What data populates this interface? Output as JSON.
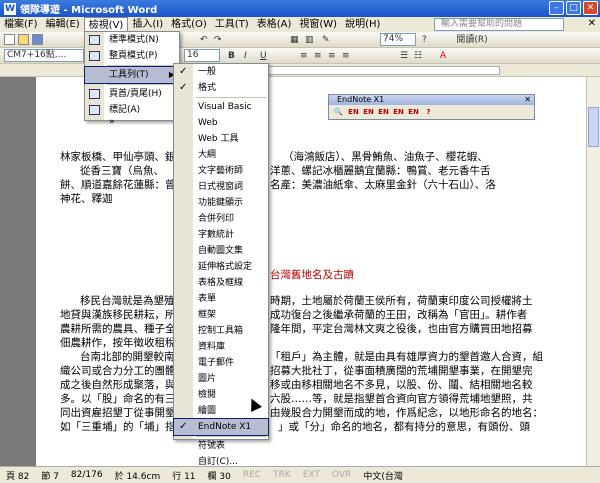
{
  "window": {
    "title": "領隊導遊 - Microsoft Word"
  },
  "menubar": {
    "items": [
      "檔案(F)",
      "編輯(E)",
      "檢視(V)",
      "插入(I)",
      "格式(O)",
      "工具(T)",
      "表格(A)",
      "視窗(W)",
      "說明(H)"
    ],
    "ask_placeholder": "輸入需要幫助的問題"
  },
  "toolbar": {
    "zoom": "74%",
    "read_label": "閱讀(R)",
    "font_name": "CM7+16點,...",
    "font_size": "16"
  },
  "view_menu": {
    "items": [
      "標準模式(N)",
      "整頁模式(P)",
      "工具列(T)",
      "頁首/頁尾(H)",
      "標記(A)"
    ],
    "more": "»"
  },
  "toolbars_menu": {
    "items": [
      {
        "label": "一般",
        "checked": true
      },
      {
        "label": "格式",
        "checked": true
      },
      {
        "label": "Visual Basic",
        "checked": false
      },
      {
        "label": "Web",
        "checked": false
      },
      {
        "label": "Web 工具",
        "checked": false
      },
      {
        "label": "大綱",
        "checked": false
      },
      {
        "label": "文字藝術師",
        "checked": false
      },
      {
        "label": "日式視窗詞",
        "checked": false
      },
      {
        "label": "功能鍵顯示",
        "checked": false
      },
      {
        "label": "合併列印",
        "checked": false
      },
      {
        "label": "字數統計",
        "checked": false
      },
      {
        "label": "自動圖文集",
        "checked": false
      },
      {
        "label": "延伸格式設定",
        "checked": false
      },
      {
        "label": "表格及框線",
        "checked": false
      },
      {
        "label": "表單",
        "checked": false
      },
      {
        "label": "框架",
        "checked": false
      },
      {
        "label": "控制工具箱",
        "checked": false
      },
      {
        "label": "資料庫",
        "checked": false
      },
      {
        "label": "電子郵件",
        "checked": false
      },
      {
        "label": "圖片",
        "checked": false
      },
      {
        "label": "檢閱",
        "checked": false
      },
      {
        "label": "繪圖",
        "checked": false
      },
      {
        "label": "EndNote X1",
        "checked": true
      },
      {
        "label": "符號表",
        "checked": false
      },
      {
        "label": "自訂(C)...",
        "checked": false
      }
    ]
  },
  "endnote": {
    "title": "EndNote X1",
    "buttons": [
      "EN",
      "EN",
      "EN",
      "EN",
      "EN"
    ]
  },
  "document": {
    "lines": [
      "林家板橋、甲仙亭頭、銀",
      "（海鴻飯店）、黑骨鮪魚、油魚子、櫻花蝦、",
      "從香三寶（烏魚、",
      "洋蔥、螺記冰櫃麗鵝宜蘭縣：鴨賞、老元香牛舌",
      "餅、順道嘉餘花蓮縣：曾",
      "名產：美濃油紙傘、太麻里金針（六十石山）、洛",
      "神花、釋迦",
      "台灣舊地名及古蹟",
      "移民台灣就是為墾殖",
      "時期，土地屬於荷蘭王侯所有，荷蘭東印度公司授權將土",
      "地貸與漢族移民耕耘，所",
      "成功復台之後繼承荷蘭的王田，改稱為「官田」。耕作者",
      "農耕所需的農具、種子全",
      "隆年間，平定台灣林文爽之役後，也由官方購買田地招募",
      "佃農耕作，按年徵收租稅",
      "台南北部的開墾較南部",
      "「租戶」為主體，就是由具有雄厚資力的墾首邀人合資，組",
      "織公司或合力分工的團體",
      "招募大批社丁，從事面積廣闊的荒埔開墾事業，在開墾完",
      "成之後自然形成聚落，與",
      "移或由移相關地名不多見，以股、份、鬮、結相關地名較",
      "多。以「股」命名的有三",
      "六股……等，就是指墾首合資向官方領得荒埔地墾照，共",
      "同出資雇招墾丁從事開墾",
      "由幾股合力開墾而成的地，作爲紀念，以地形命名的地名：",
      "如「三重埔」的「埔」指",
      "」或「分」命名的地名，都有持分的意思，有頭份、頭"
    ]
  },
  "statusbar": {
    "items": [
      "頁 82",
      "節 7",
      "82/176",
      "於 14.6cm",
      "行 11",
      "欄 30",
      "REC",
      "TRK",
      "EXT",
      "OVR",
      "中文(台灣"
    ]
  }
}
